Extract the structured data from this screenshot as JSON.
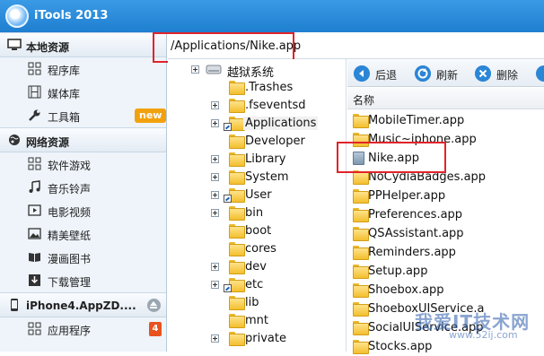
{
  "app": {
    "title": "iTools 2013"
  },
  "address": {
    "path": "/Applications/Nike.app"
  },
  "sidebar": {
    "sections": [
      {
        "title": "本地资源",
        "items": [
          {
            "label": "程序库"
          },
          {
            "label": "媒体库"
          },
          {
            "label": "工具箱",
            "badge": "new"
          }
        ]
      },
      {
        "title": "网络资源",
        "items": [
          {
            "label": "软件游戏"
          },
          {
            "label": "音乐铃声"
          },
          {
            "label": "电影视频"
          },
          {
            "label": "精美壁纸"
          },
          {
            "label": "漫画图书"
          },
          {
            "label": "下载管理"
          }
        ]
      },
      {
        "title": "iPhone4.AppZD....",
        "items": [
          {
            "label": "应用程序",
            "badge": "4"
          }
        ]
      }
    ]
  },
  "tree": {
    "root": "越狱系统",
    "items": [
      ".Trashes",
      ".fseventsd",
      "Applications",
      "Developer",
      "Library",
      "System",
      "User",
      "bin",
      "boot",
      "cores",
      "dev",
      "etc",
      "lib",
      "mnt",
      "private"
    ]
  },
  "toolbar": {
    "back": "后退",
    "refresh": "刷新",
    "delete": "删除"
  },
  "list": {
    "header": "名称",
    "items": [
      "MobileTimer.app",
      "Music~iphone.app",
      "Nike.app",
      "NoCydiaBadges.app",
      "PPHelper.app",
      "Preferences.app",
      "QSAssistant.app",
      "Reminders.app",
      "Setup.app",
      "Shoebox.app",
      "ShoeboxUIService.a",
      "SocialUIService.app",
      "Stocks.app"
    ]
  },
  "watermark": {
    "text": "我爱IT技术网",
    "url": "www.52ij.com"
  },
  "colors": {
    "titlebar": "#1f7fd0",
    "highlight_box": "#e0242a",
    "badge_new": "#f2a10e",
    "badge_count": "#e8531f"
  }
}
